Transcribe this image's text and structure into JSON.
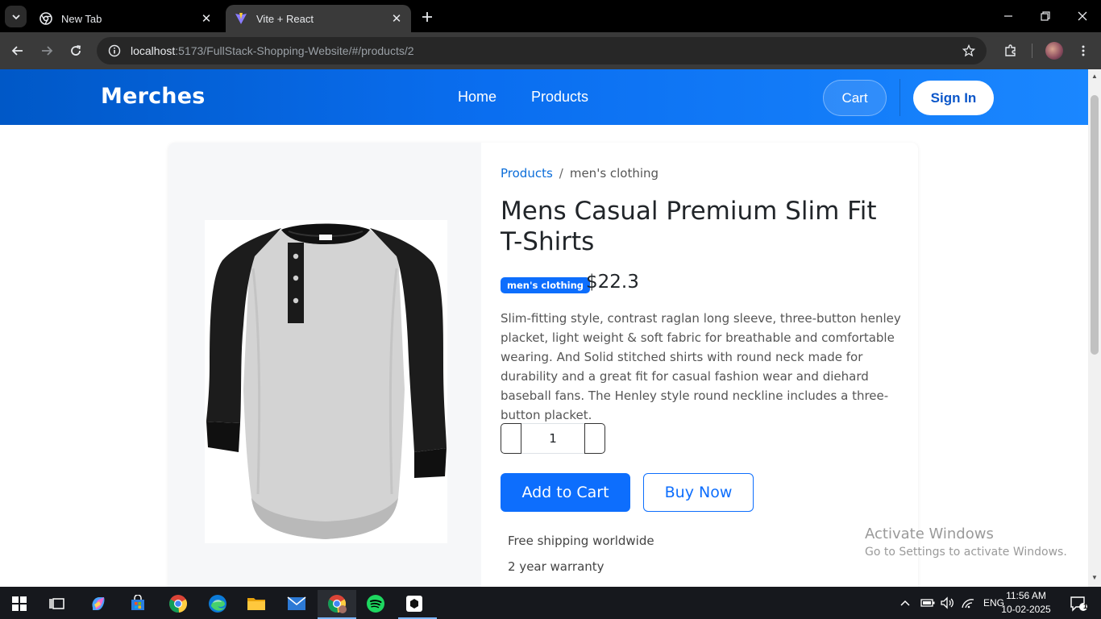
{
  "browser": {
    "tabs": [
      {
        "title": "New Tab",
        "active": false
      },
      {
        "title": "Vite + React",
        "active": true
      }
    ],
    "url_host": "localhost",
    "url_rest": ":5173/FullStack-Shopping-Website/#/products/2"
  },
  "header": {
    "brand": "Merches",
    "nav": [
      "Home",
      "Products"
    ],
    "cart_label": "Cart",
    "signin_label": "Sign In"
  },
  "product": {
    "breadcrumb_link": "Products",
    "breadcrumb_separator": "/",
    "breadcrumb_current": "men's clothing",
    "title": "Mens Casual Premium Slim Fit T-Shirts",
    "category_badge": "men's clothing",
    "price": "$22.3",
    "description": "Slim-fitting style, contrast raglan long sleeve, three-button henley placket, light weight & soft fabric for breathable and comfortable wearing. And Solid stitched shirts with round neck made for durability and a great fit for casual fashion wear and diehard baseball fans. The Henley style round neckline includes a three-button placket.",
    "quantity": "1",
    "add_to_cart_label": "Add to Cart",
    "buy_now_label": "Buy Now",
    "features": [
      "Free shipping worldwide",
      "2 year warranty"
    ]
  },
  "watermark": {
    "line1": "Activate Windows",
    "line2": "Go to Settings to activate Windows."
  },
  "taskbar": {
    "language": "ENG",
    "time": "11:56 AM",
    "date": "10-02-2025",
    "notification_count": "1"
  },
  "colors": {
    "header_gradient_start": "#0058c7",
    "header_gradient_end": "#1a87ff",
    "primary": "#0d6efd",
    "browser_dark": "#3a3a3a"
  }
}
